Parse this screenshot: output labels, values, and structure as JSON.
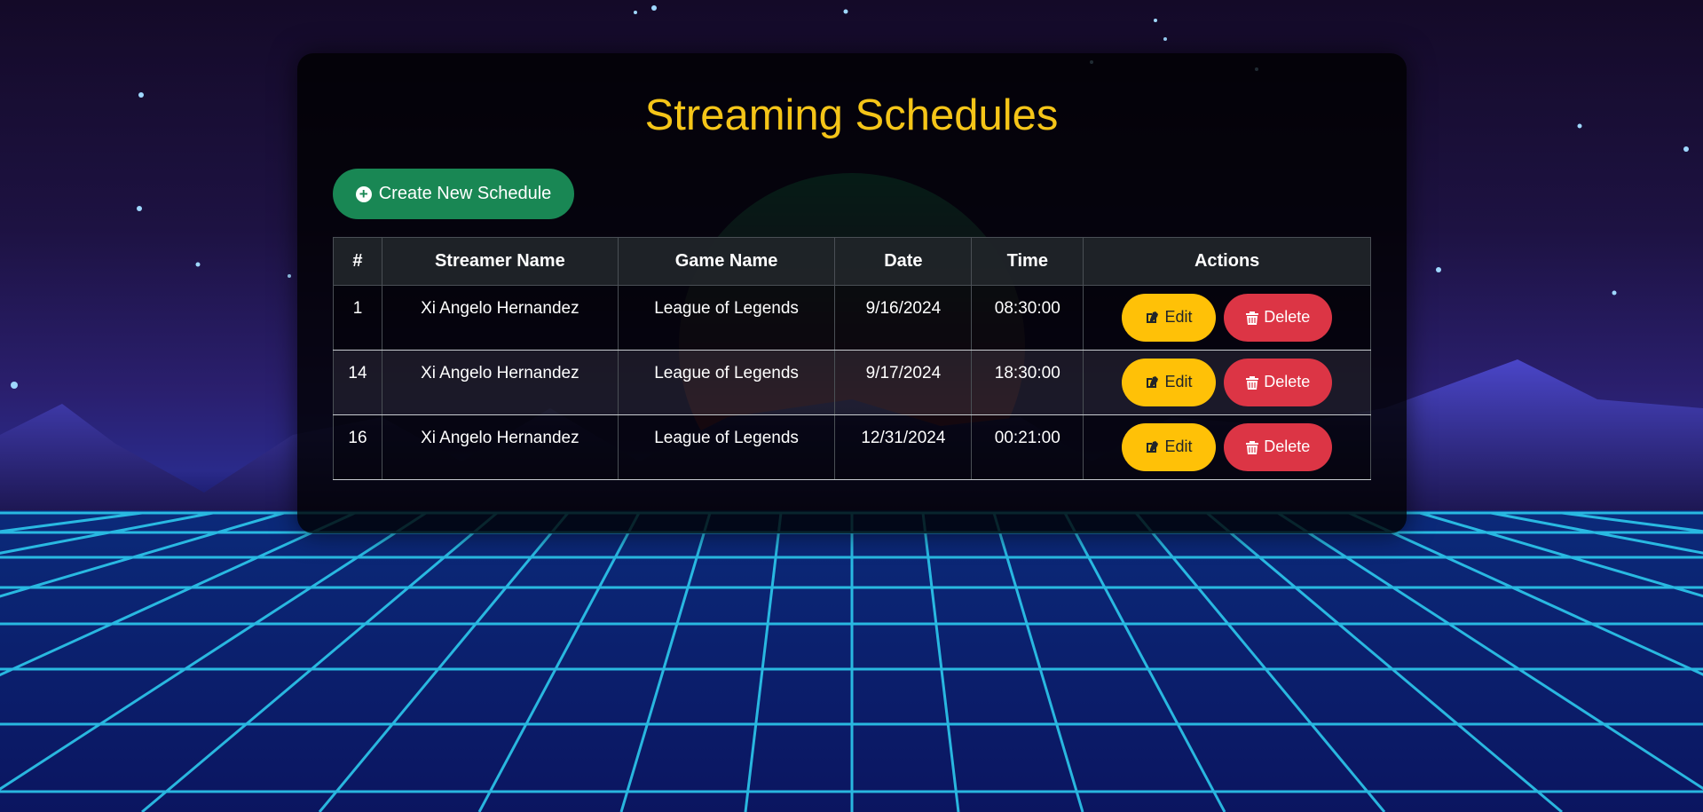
{
  "page": {
    "title": "Streaming Schedules",
    "create_label": "Create New Schedule"
  },
  "table": {
    "headers": [
      "#",
      "Streamer Name",
      "Game Name",
      "Date",
      "Time",
      "Actions"
    ],
    "rows": [
      {
        "id": "1",
        "streamer": "Xi Angelo Hernandez",
        "game": "League of Legends",
        "date": "9/16/2024",
        "time": "08:30:00"
      },
      {
        "id": "14",
        "streamer": "Xi Angelo Hernandez",
        "game": "League of Legends",
        "date": "9/17/2024",
        "time": "18:30:00"
      },
      {
        "id": "16",
        "streamer": "Xi Angelo Hernandez",
        "game": "League of Legends",
        "date": "12/31/2024",
        "time": "00:21:00"
      }
    ],
    "edit_label": "Edit",
    "delete_label": "Delete"
  },
  "icons": {
    "create": "plus-circle-icon",
    "edit": "edit-icon",
    "delete": "trash-icon"
  },
  "colors": {
    "title": "#f5c518",
    "create_button": "#198754",
    "edit_button": "#ffc107",
    "delete_button": "#dc3545",
    "grid": "#2fd3f5"
  }
}
